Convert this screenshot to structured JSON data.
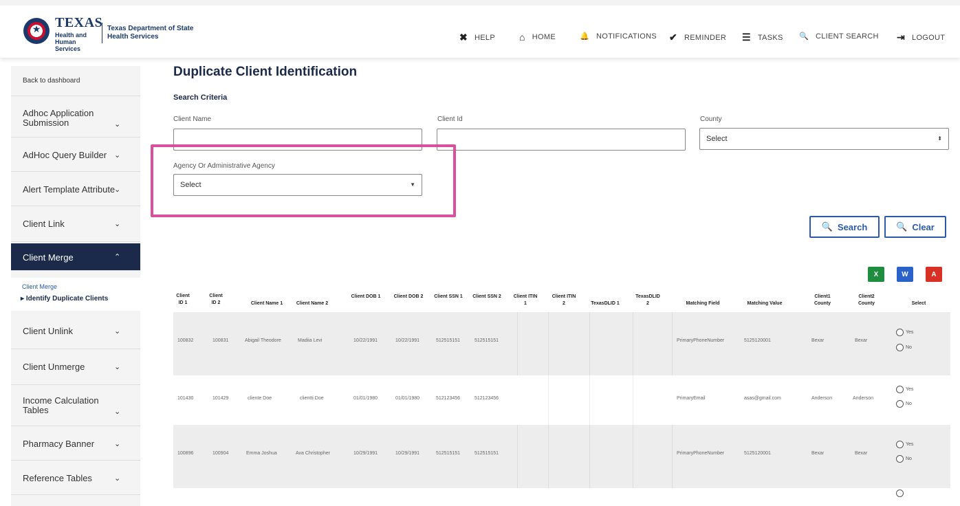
{
  "header": {
    "logo_texas": "TEXAS",
    "logo_sub": "Health and Human Services",
    "logo_dept": "Texas Department of State Health Services",
    "nav": [
      {
        "icon": "help-icon",
        "glyph": "✖",
        "label": "HELP"
      },
      {
        "icon": "home-icon",
        "glyph": "⌂",
        "label": "HOME"
      },
      {
        "icon": "bell-icon",
        "glyph": "🔔",
        "label": "NOTIFICATIONS"
      },
      {
        "icon": "check-icon",
        "glyph": "✔",
        "label": "REMINDER"
      },
      {
        "icon": "list-icon",
        "glyph": "☰",
        "label": "TASKS"
      },
      {
        "icon": "search-icon",
        "glyph": "🔍",
        "label": "CLIENT SEARCH"
      },
      {
        "icon": "logout-icon",
        "glyph": "⇥",
        "label": "LOGOUT"
      }
    ]
  },
  "sidebar": {
    "back": "Back to dashboard",
    "items": [
      {
        "label": "Adhoc Application Submission"
      },
      {
        "label": "AdHoc Query Builder"
      },
      {
        "label": "Alert Template Attribute"
      },
      {
        "label": "Client Link"
      },
      {
        "label": "Client Merge",
        "active": true
      },
      {
        "label": "Client Unlink"
      },
      {
        "label": "Client Unmerge"
      },
      {
        "label": "Income Calculation Tables"
      },
      {
        "label": "Pharmacy Banner"
      },
      {
        "label": "Reference Tables"
      }
    ],
    "sub_link": "Client Merge",
    "sub_current": "Identify Duplicate Clients"
  },
  "main": {
    "title": "Duplicate Client Identification",
    "section": "Search Criteria",
    "fields": {
      "client_name_label": "Client Name",
      "client_name_value": "",
      "client_id_label": "Client Id",
      "client_id_value": "",
      "county_label": "County",
      "county_value": "Select",
      "agency_label": "Agency Or Administrative Agency",
      "agency_value": "Select"
    },
    "buttons": {
      "search": "Search",
      "clear": "Clear"
    },
    "exports": [
      {
        "name": "excel-export-icon",
        "glyph": "X",
        "color": "#1e8e3e"
      },
      {
        "name": "word-export-icon",
        "glyph": "W",
        "color": "#2a62c9"
      },
      {
        "name": "pdf-export-icon",
        "glyph": "A",
        "color": "#d93025"
      }
    ]
  },
  "table": {
    "columns": [
      "Client ID 1",
      "Client ID 2",
      "Client Name 1",
      "Client Name 2",
      "Client DOB 1",
      "Client DOB 2",
      "Client SSN 1",
      "Client SSN 2",
      "Client ITIN 1",
      "Client ITIN 2",
      "TexasDLID 1",
      "TexasDLID 2",
      "Matching Field",
      "Matching Value",
      "Client1 County",
      "Client2 County",
      "Select"
    ],
    "rows": [
      [
        "100832",
        "100831",
        "Abigail Theodore",
        "Madiia Levi",
        "10/22/1991",
        "10/22/1991",
        "512515151",
        "512515151",
        "",
        "",
        "",
        "",
        "PrimaryPhoneNumber",
        "5125120001",
        "Bexar",
        "Bexar"
      ],
      [
        "101430",
        "101429",
        "cliente Doe",
        "clientti Doe",
        "01/01/1980",
        "01/01/1980",
        "512123456",
        "512123456",
        "",
        "",
        "",
        "",
        "PrimaryEmail",
        "asas@gmail.com",
        "Anderson",
        "Anderson"
      ],
      [
        "100896",
        "100904",
        "Emma Joshua",
        "Ava Christopher",
        "10/29/1991",
        "10/29/1991",
        "512515151",
        "512515151",
        "",
        "",
        "",
        "",
        "PrimaryPhoneNumber",
        "5125120001",
        "Bexar",
        "Bexar"
      ]
    ],
    "radio_yes": "Yes",
    "radio_no": "No"
  }
}
